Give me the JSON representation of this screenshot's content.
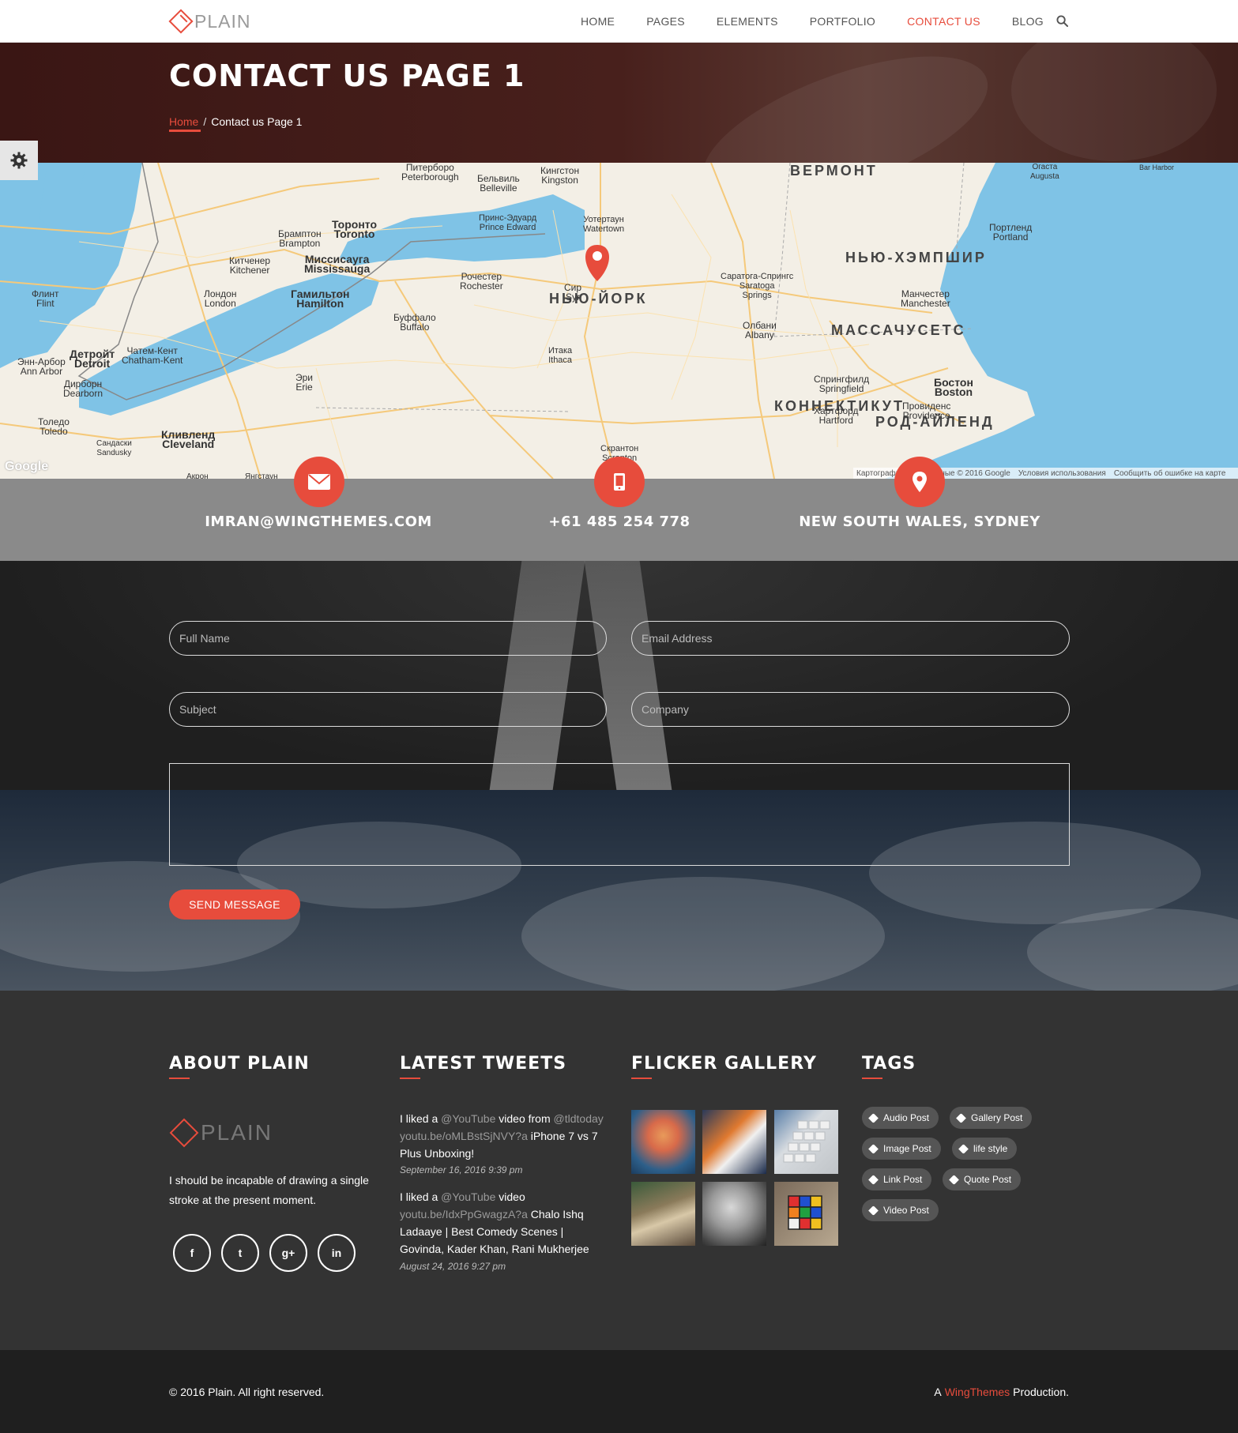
{
  "site": {
    "logo_text": "PLAIN"
  },
  "nav": {
    "items": [
      {
        "label": "HOME"
      },
      {
        "label": "PAGES"
      },
      {
        "label": "ELEMENTS"
      },
      {
        "label": "PORTFOLIO"
      },
      {
        "label": "CONTACT US"
      },
      {
        "label": "BLOG"
      }
    ],
    "active_index": 4,
    "search_icon": "search-icon"
  },
  "hero": {
    "title": "CONTACT US PAGE 1",
    "breadcrumb": {
      "home": "Home",
      "separator": "/",
      "current": "Contact us Page 1"
    }
  },
  "map": {
    "labels": {
      "vermont": "ВЕРМОНТ",
      "newhampshire": "НЬЮ-ХЭМПШИР",
      "newyork": "НЬЮ-ЙОРК",
      "massachusetts": "МАССАЧУСЕТС",
      "connecticut": "КОННЕКТИКУТ",
      "rhode": "РОД-АЙЛЕНД",
      "toronto": "Торонто\nToronto",
      "mississauga": "Миссисауга\nMississauga",
      "hamilton": "Гамильтон\nHamilton",
      "detroit": "Детройт\nDetroit",
      "cleveland": "Кливленд\nCleveland",
      "boston": "Бостон\nBoston",
      "kingston": "Кингстон\nKingston",
      "belleville": "Бельвиль\nBelleville",
      "peterborough": "Питерборо\nPeterborough",
      "brampton": "Брамптон\nBrampton",
      "kitchener": "Китченер\nKitchener",
      "london": "Лондон\nLondon",
      "flint": "Флинт\nFlint",
      "annarbor": "Энн-Арбор\nAnn Arbor",
      "dearborn": "Дирборн\nDearborn",
      "toledo": "Толедо\nToledo",
      "sandusky": "Сандаски\nSandusky",
      "chatham": "Чатем-Кент\nChatham-Kent",
      "erie": "Эри\nErie",
      "buffalo": "Буффало\nBuffalo",
      "rochester": "Рочестер\nRochester",
      "watertown": "Уотертаун\nWatertown",
      "princeedward": "Принс-Эдуард\nPrince Edward",
      "ithaca": "Итака\nIthaca",
      "scranton": "Скрантон\nScranton",
      "saratoga": "Саратога-Спрингс\nSaratoga\nSprings",
      "albany": "Олбани\nAlbany",
      "springfield": "Спрингфилд\nSpringfield",
      "hartford": "Хартфорд\nHartford",
      "providence": "Провиденс\nProvidence",
      "manchester": "Манчестер\nManchester",
      "portland": "Портленд\nPortland",
      "augusta": "Огаста\nAugusta",
      "barharbor": "Bar Harbor",
      "akron": "Акрон",
      "syracuse": "Сир\nSyr",
      "yangstown": "Янгстаун"
    },
    "google": "Google",
    "footer": [
      "Картографические данные © 2016 Google",
      "Условия использования",
      "Сообщить об ошибке на карте"
    ]
  },
  "contact_info": [
    {
      "icon": "envelope-icon",
      "text": "IMRAN@WINGTHEMES.COM"
    },
    {
      "icon": "mobile-phone-icon",
      "text": "+61 485 254 778"
    },
    {
      "icon": "map-pin-icon",
      "text": "NEW SOUTH WALES, SYDNEY"
    }
  ],
  "form": {
    "full_name_placeholder": "Full Name",
    "email_placeholder": "Email Address",
    "subject_placeholder": "Subject",
    "company_placeholder": "Company",
    "message_placeholder": "",
    "send_label": "SEND MESSAGE"
  },
  "footer": {
    "about": {
      "heading": "ABOUT PLAIN",
      "logo_text": "PLAIN",
      "text": "I should be incapable of drawing a single stroke at the present moment.",
      "social": [
        {
          "icon": "facebook-icon",
          "glyph": "f"
        },
        {
          "icon": "twitter-icon",
          "glyph": "t"
        },
        {
          "icon": "google-plus-icon",
          "glyph": "g+"
        },
        {
          "icon": "linkedin-icon",
          "glyph": "in"
        }
      ]
    },
    "tweets": {
      "heading": "LATEST TWEETS",
      "items": [
        {
          "prefix": "I liked a ",
          "handle": "@YouTube",
          "mid": " video from ",
          "handle2": "@tldtoday",
          "link": "youtu.be/oMLBstSjNVY?a",
          "text": " iPhone 7 vs 7 Plus Unboxing!",
          "date": "September 16, 2016 9:39 pm"
        },
        {
          "prefix": "I liked a ",
          "handle": "@YouTube",
          "mid": " video ",
          "handle2": "",
          "link": "youtu.be/IdxPpGwagzA?a",
          "text": " Chalo Ishq Ladaaye | Best Comedy Scenes | Govinda, Kader Khan, Rani Mukherjee",
          "date": "August 24, 2016 9:27 pm"
        }
      ]
    },
    "gallery": {
      "heading": "FLICKER GALLERY"
    },
    "tags": {
      "heading": "TAGS",
      "items": [
        "Audio Post",
        "Gallery Post",
        "Image Post",
        "life style",
        "Link Post",
        "Quote Post",
        "Video Post"
      ]
    }
  },
  "bottom": {
    "copyright": "© 2016 Plain. All right reserved.",
    "credit_prefix": "A",
    "credit_brand": "WingThemes",
    "credit_suffix": "Production."
  },
  "colors": {
    "accent": "#e74c3c",
    "hero": "#3d1a17",
    "footer": "#333333",
    "bottom": "#1f1f1f",
    "contact_bar": "#8a8a8a"
  }
}
